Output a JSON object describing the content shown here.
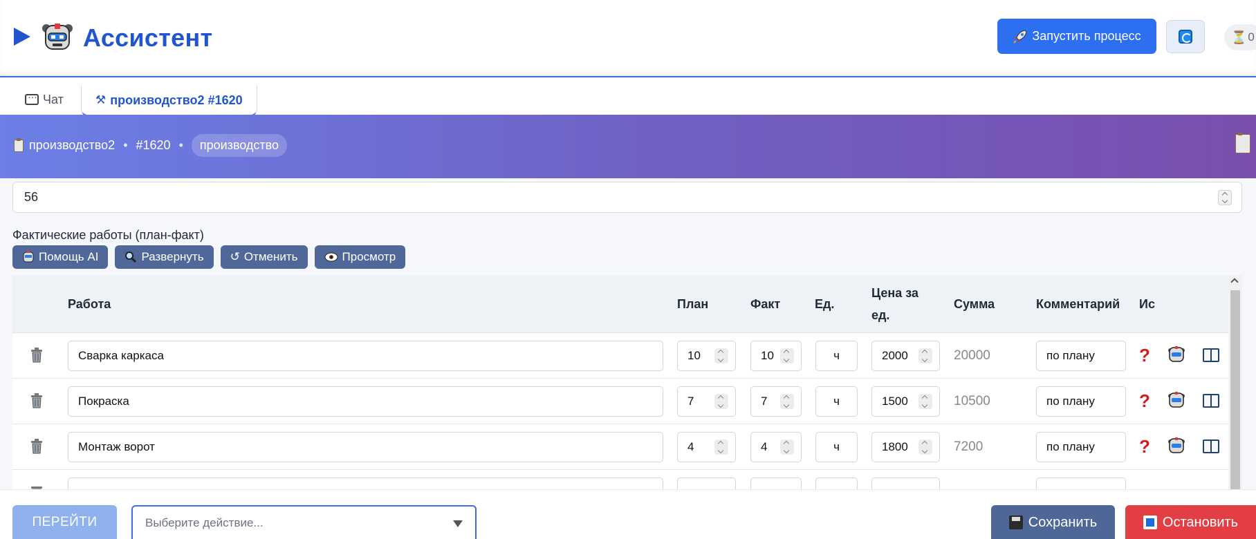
{
  "app": {
    "title": "Ассистент"
  },
  "header": {
    "launch_label": "Запустить процесс",
    "timer_count": "0"
  },
  "tabs": [
    {
      "label": "Чат"
    },
    {
      "label": "производство2 #1620"
    }
  ],
  "breadcrumb": {
    "name": "производство2",
    "id": "#1620",
    "tag": "производство"
  },
  "number_field": {
    "value": "56"
  },
  "section": {
    "label": "Фактические работы (план-факт)",
    "buttons": [
      {
        "label": "Помощь AI",
        "icon": "robot-icon"
      },
      {
        "label": "Развернуть",
        "icon": "magnifier-icon"
      },
      {
        "label": "Отменить",
        "icon": "undo-icon"
      },
      {
        "label": "Просмотр",
        "icon": "eye-icon"
      }
    ]
  },
  "table": {
    "headers": [
      "Работа",
      "План",
      "Факт",
      "Ед.",
      "Цена за ед.",
      "Сумма",
      "Комментарий",
      "Ис"
    ],
    "rows": [
      {
        "work": "Сварка каркаса",
        "plan": "10",
        "fact": "10",
        "unit": "ч",
        "price": "2000",
        "sum": "20000",
        "comment": "по плану"
      },
      {
        "work": "Покраска",
        "plan": "7",
        "fact": "7",
        "unit": "ч",
        "price": "1500",
        "sum": "10500",
        "comment": "по плану"
      },
      {
        "work": "Монтаж ворот",
        "plan": "4",
        "fact": "4",
        "unit": "ч",
        "price": "1800",
        "sum": "7200",
        "comment": "по плану"
      }
    ]
  },
  "footer": {
    "go_label": "ПЕРЕЙТИ",
    "select_placeholder": "Выберите действие...",
    "save_label": "Сохранить",
    "stop_label": "Остановить"
  },
  "colors": {
    "accent": "#2155cf",
    "primary_button": "#2c6ff0",
    "toolbar_button": "#50679a",
    "stop": "#e23e44",
    "banner_start": "#6b7fe6",
    "banner_end": "#7a4fae"
  }
}
